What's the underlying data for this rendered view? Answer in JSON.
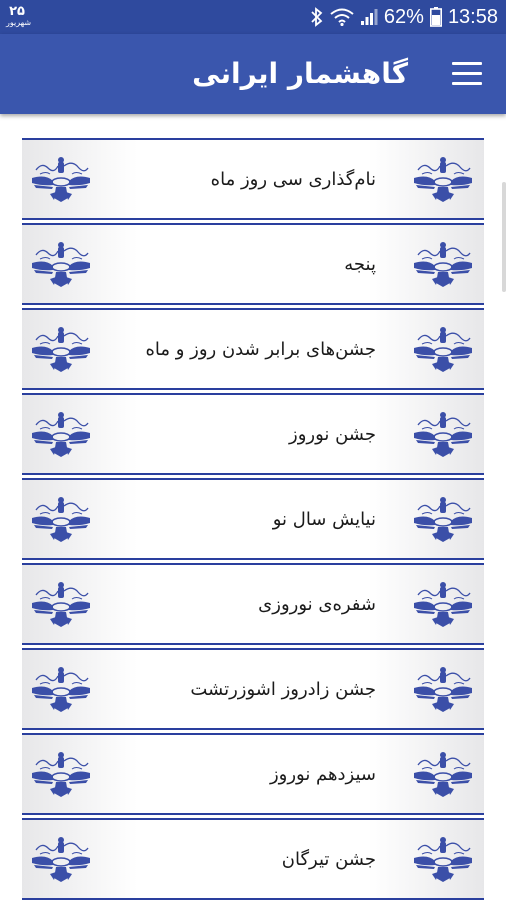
{
  "status_bar": {
    "date_number": "۲۵",
    "date_month": "شهریور",
    "battery": "62%",
    "time": "13:58"
  },
  "app_bar": {
    "title": "گاهشمار ایرانی"
  },
  "list": {
    "items": [
      {
        "label": "نام‌گذاری سی روز ماه"
      },
      {
        "label": "پنجه"
      },
      {
        "label": "جشن‌های برابر شدن روز و ماه"
      },
      {
        "label": "جشن نوروز"
      },
      {
        "label": "نیایش سال نو"
      },
      {
        "label": "شفره‌ی نوروزی"
      },
      {
        "label": "جشن زادروز اشوزرتشت"
      },
      {
        "label": "سیزدهم نوروز"
      },
      {
        "label": "جشن تیرگان"
      }
    ]
  },
  "icons": {
    "list_item_icon": "faravahar-icon",
    "menu": "hamburger-menu-icon"
  },
  "colors": {
    "status_bar": "#2f4a9e",
    "app_bar": "#3a56ad",
    "item_border": "#2a3f9e",
    "icon": "#3b4fa8"
  }
}
